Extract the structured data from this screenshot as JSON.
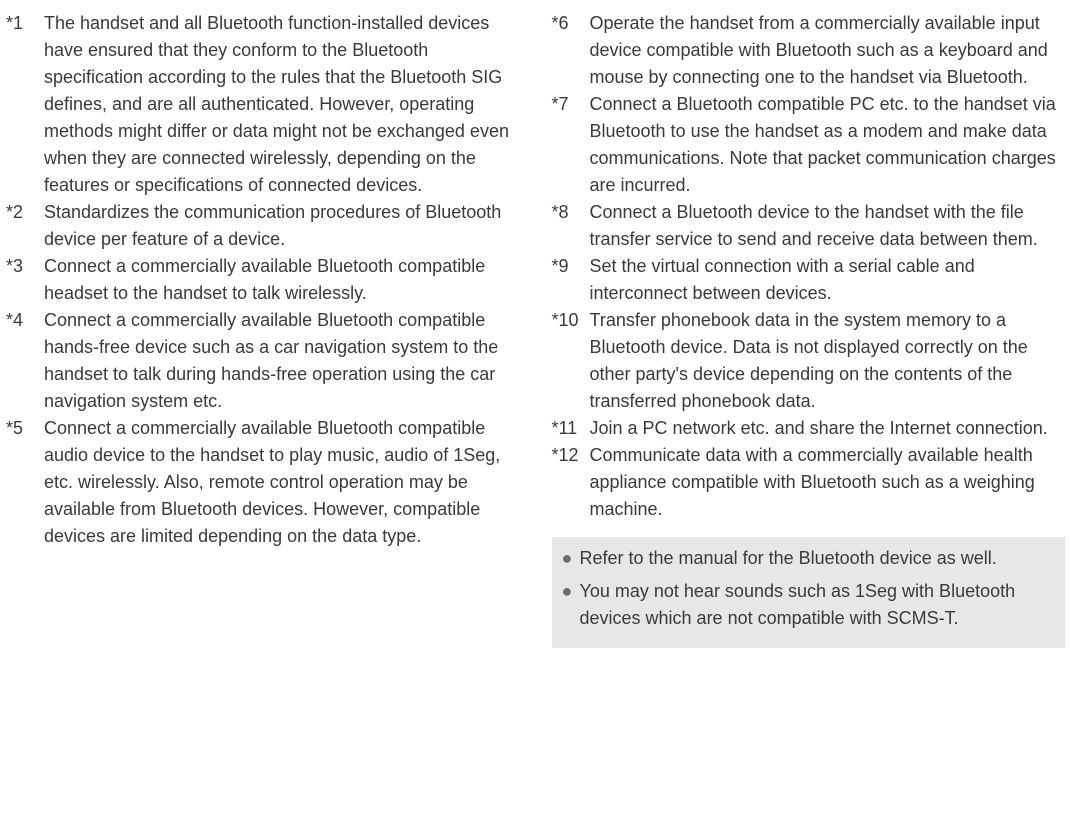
{
  "left_notes": [
    {
      "num": "*1",
      "text": "The handset and all Bluetooth function-installed devices have ensured that they conform to the Bluetooth specification according to the rules that the Bluetooth SIG defines, and are all authenticated. However, operating methods might differ or data might not be exchanged even when they are connected wirelessly, depending on the features or specifications of connected devices."
    },
    {
      "num": "*2",
      "text": "Standardizes the communication procedures of Bluetooth device per feature of a device."
    },
    {
      "num": "*3",
      "text": "Connect a commercially available Bluetooth compatible headset to the handset to talk wirelessly."
    },
    {
      "num": "*4",
      "text": "Connect a commercially available Bluetooth compatible hands-free device such as a car navigation system to the handset to talk during hands-free operation using the car navigation system etc."
    },
    {
      "num": "*5",
      "text": "Connect a commercially available Bluetooth compatible audio device to the handset to play music, audio of 1Seg, etc. wirelessly. Also, remote control operation may be available from Bluetooth devices. However, compatible devices are limited depending on the data type."
    }
  ],
  "right_notes": [
    {
      "num": "*6",
      "text": "Operate the handset from a commercially available input device compatible with Bluetooth such as a keyboard and mouse by connecting one to the handset via Bluetooth."
    },
    {
      "num": "*7",
      "text": "Connect a Bluetooth compatible PC etc. to the handset via Bluetooth to use the handset as a modem and make data communications. Note that packet communication charges are incurred."
    },
    {
      "num": "*8",
      "text": "Connect a Bluetooth device to the handset with the file transfer service to send and receive data between them."
    },
    {
      "num": "*9",
      "text": "Set the virtual connection with a serial cable and interconnect between devices."
    },
    {
      "num": "*10",
      "text": "Transfer phonebook data in the system memory to a Bluetooth device. Data is not displayed correctly on the other party's device depending on the contents of the transferred phonebook data."
    },
    {
      "num": "*11",
      "text": "Join a PC network etc. and share the Internet connection."
    },
    {
      "num": "*12",
      "text": "Communicate data with a commercially available health appliance compatible with Bluetooth such as a weighing machine."
    }
  ],
  "info_bullets": [
    "Refer to the manual for the Bluetooth device as well.",
    "You may not hear sounds such as 1Seg with Bluetooth devices which are not compatible with SCMS-T."
  ]
}
